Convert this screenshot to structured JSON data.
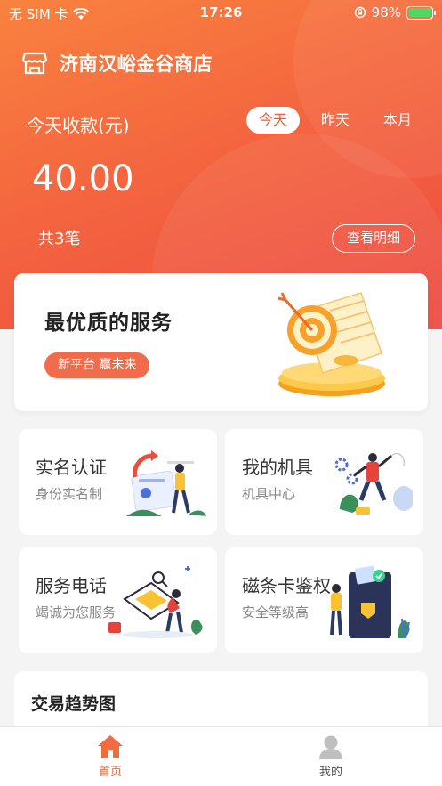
{
  "status_bar": {
    "carrier": "无 SIM 卡",
    "time": "17:26",
    "battery": "98%"
  },
  "store": {
    "name": "济南汉峪金谷商店"
  },
  "revenue": {
    "label": "今天收款(元)",
    "periods": [
      "今天",
      "昨天",
      "本月"
    ],
    "selected_period": "今天",
    "amount": "40.00",
    "count": "共3笔",
    "detail_button": "查看明细"
  },
  "banner": {
    "title": "最优质的服务",
    "tag": "新平台 赢未来"
  },
  "services": [
    {
      "title": "实名认证",
      "subtitle": "身份实名制"
    },
    {
      "title": "我的机具",
      "subtitle": "机具中心"
    },
    {
      "title": "服务电话",
      "subtitle": "竭诚为您服务"
    },
    {
      "title": "磁条卡鉴权",
      "subtitle": "安全等级高"
    }
  ],
  "trend": {
    "title": "交易趋势图"
  },
  "tabbar": {
    "items": [
      {
        "label": "首页",
        "active": true
      },
      {
        "label": "我的",
        "active": false
      }
    ]
  },
  "colors": {
    "accent": "#f26b3e",
    "hero_start": "#f9823f",
    "hero_end": "#ee4a43",
    "battery": "#4cd964"
  }
}
